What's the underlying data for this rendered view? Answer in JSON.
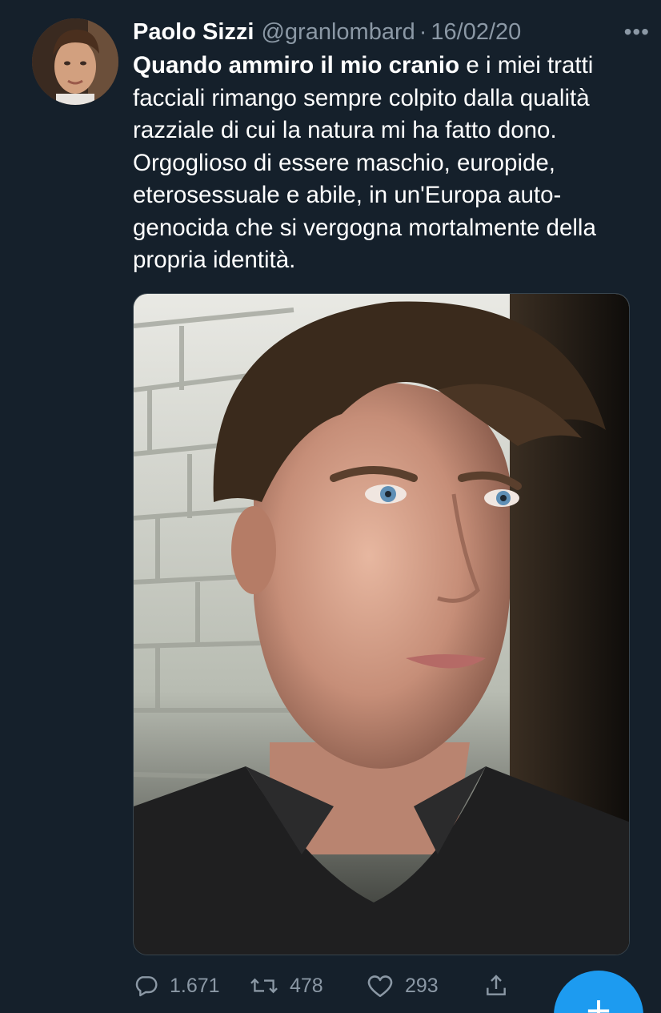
{
  "tweet": {
    "author_name": "Paolo Sizzi",
    "handle": "@granlombard",
    "separator": "·",
    "date": "16/02/20",
    "more_icon": "more-horizontal-icon",
    "text_bold": "Quando ammiro il mio cranio",
    "text_rest": " e i miei tratti facciali rimango sempre colpito dalla qualità razziale di cui la natura mi ha fatto dono. Orgoglioso di essere maschio, europide, eterosessuale e abile, in un'Europa auto-genocida che si vergogna mortalmente della propria identità."
  },
  "actions": {
    "reply_count": "1.671",
    "retweet_count": "478",
    "like_count": "293"
  },
  "icons": {
    "reply": "reply-icon",
    "retweet": "retweet-icon",
    "like": "heart-icon",
    "share": "share-icon",
    "compose": "compose-plus-icon"
  },
  "fab": {
    "label": "+"
  },
  "colors": {
    "background": "#15202b",
    "secondary_text": "#8b98a5",
    "accent": "#1d9bf0"
  }
}
